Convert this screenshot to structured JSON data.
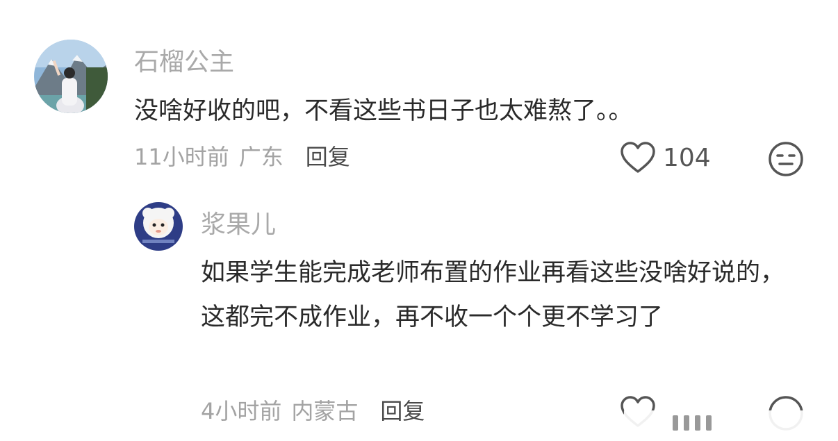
{
  "comments": [
    {
      "username": "石榴公主",
      "avatar": "mountain-photo-avatar",
      "text": "没啥好收的吧，不看这些书日子也太难熬了。。",
      "time": "11小时前",
      "location": "广东",
      "reply_label": "回复",
      "likes": "104",
      "like_icon": "heart-icon",
      "dislike_icon": "neutral-face-icon"
    },
    {
      "username": "浆果儿",
      "avatar": "cartoon-sheep-avatar",
      "text": "如果学生能完成老师布置的作业再看这些没啥好说的，这都完不成作业，再不收一个个更不学习了",
      "time": "4小时前",
      "location": "内蒙古",
      "reply_label": "回复"
    }
  ]
}
